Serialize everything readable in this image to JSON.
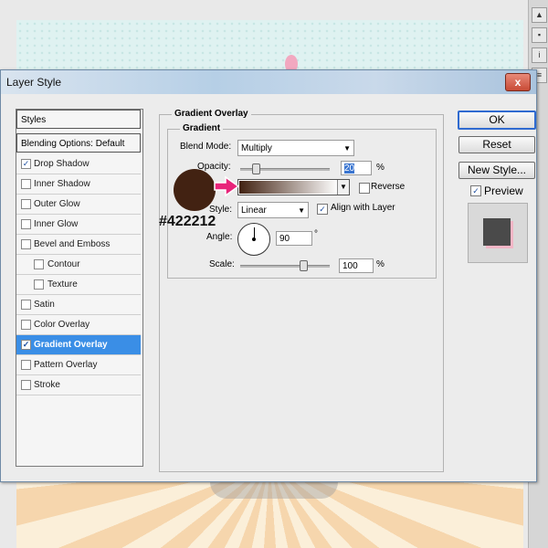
{
  "dialog": {
    "title": "Layer Style",
    "close_label": "x"
  },
  "styles_list": {
    "header": "Styles",
    "blending": "Blending Options: Default",
    "items": [
      {
        "label": "Drop Shadow",
        "checked": true
      },
      {
        "label": "Inner Shadow",
        "checked": false
      },
      {
        "label": "Outer Glow",
        "checked": false
      },
      {
        "label": "Inner Glow",
        "checked": false
      },
      {
        "label": "Bevel and Emboss",
        "checked": false
      },
      {
        "label": "Contour",
        "checked": false
      },
      {
        "label": "Texture",
        "checked": false
      },
      {
        "label": "Satin",
        "checked": false
      },
      {
        "label": "Color Overlay",
        "checked": false
      },
      {
        "label": "Gradient Overlay",
        "checked": true
      },
      {
        "label": "Pattern Overlay",
        "checked": false
      },
      {
        "label": "Stroke",
        "checked": false
      }
    ]
  },
  "panel": {
    "section_title": "Gradient Overlay",
    "group_title": "Gradient",
    "blend_mode_label": "Blend Mode:",
    "blend_mode_value": "Multiply",
    "opacity_label": "Opacity:",
    "opacity_value": "20",
    "opacity_unit": "%",
    "opacity_level": 20,
    "gradient_label": "Gradient:",
    "reverse_label": "Reverse",
    "reverse_checked": false,
    "style_label": "Style:",
    "style_value": "Linear",
    "align_label": "Align with Layer",
    "align_checked": true,
    "angle_label": "Angle:",
    "angle_value": "90",
    "angle_unit": "°",
    "scale_label": "Scale:",
    "scale_value": "100",
    "scale_unit": "%",
    "scale_level": 100
  },
  "buttons": {
    "ok": "OK",
    "reset": "Reset",
    "new_style": "New Style...",
    "preview_label": "Preview",
    "preview_checked": true
  },
  "annotation": {
    "color_hex": "#422212"
  },
  "colors": {
    "swatch": "#422212",
    "arrow": "#e8247a",
    "selection": "#3a8ee6"
  }
}
